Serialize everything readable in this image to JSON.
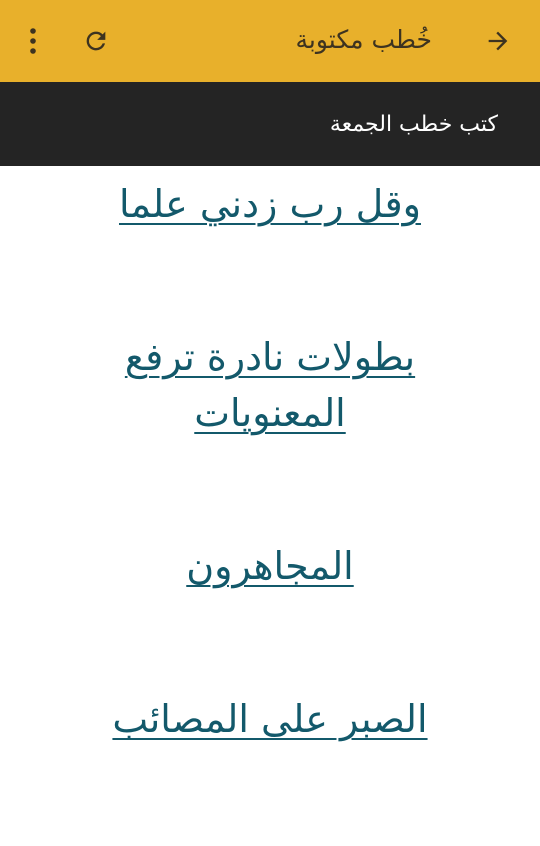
{
  "toolbar": {
    "title": "خُطب مكتوبة",
    "icons": {
      "back": "arrow-right-icon",
      "refresh": "refresh-icon",
      "more": "more-vert-icon"
    },
    "background_color": "#e8b02b"
  },
  "subbar": {
    "title": "كتب خطب الجمعة",
    "background_color": "#242424"
  },
  "sermons": [
    {
      "title": "وقل رب زدني علما"
    },
    {
      "title": "بطولات نادرة ترفع المعنويات"
    },
    {
      "title": "المجاهرون"
    },
    {
      "title": "الصبر على المصائب"
    }
  ],
  "link_color": "#13596b"
}
